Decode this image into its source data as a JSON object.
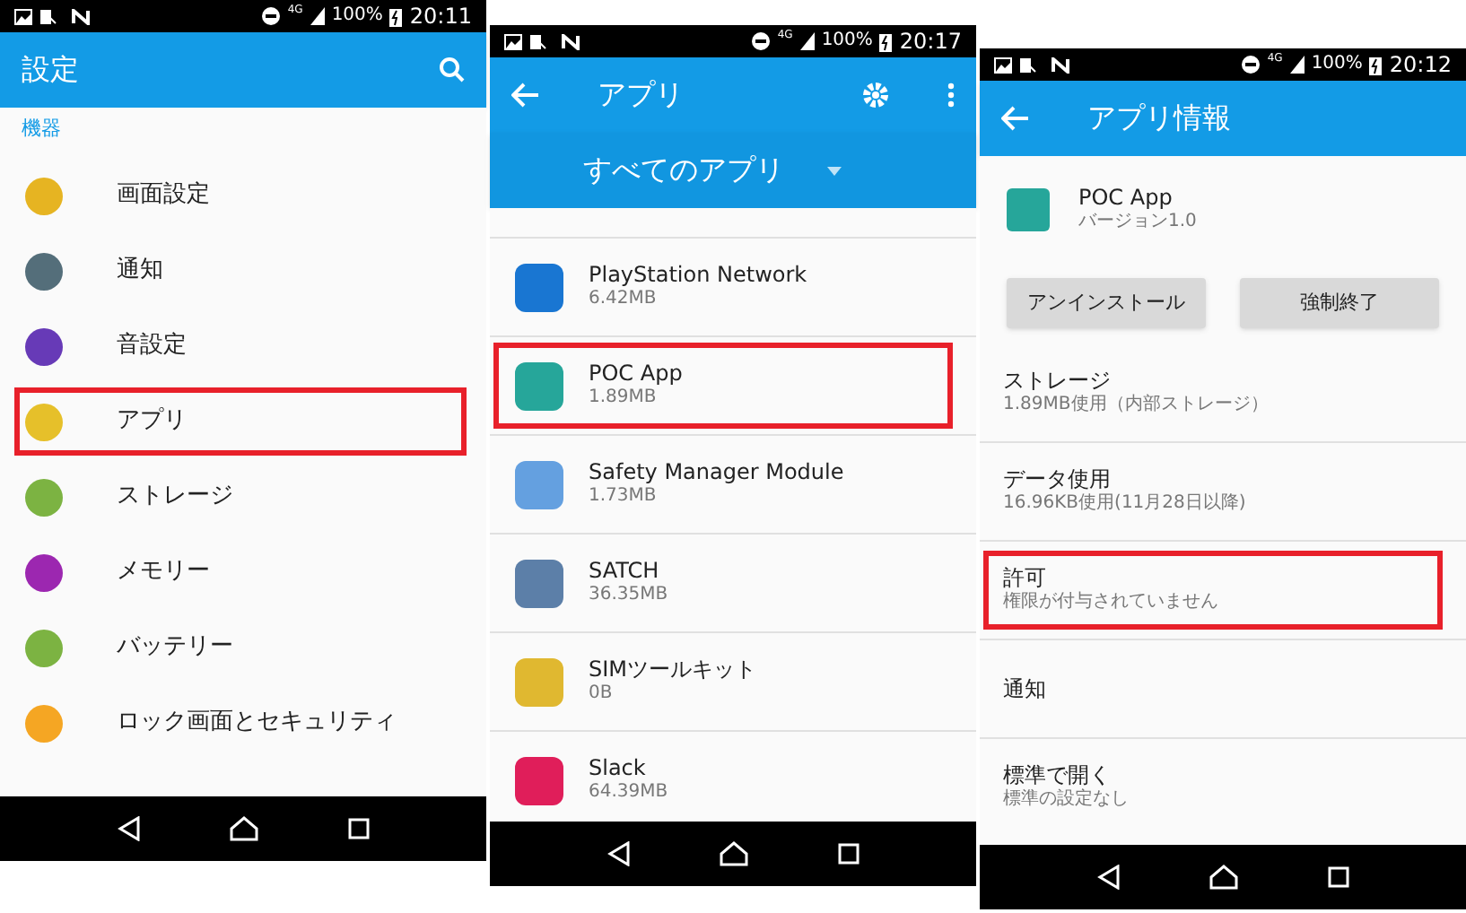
{
  "screens": [
    {
      "kind": "settings",
      "status": {
        "time": "20:11",
        "battery": "100%",
        "network": "4G"
      },
      "title": "設定",
      "section": "機器",
      "items": [
        {
          "label": "画面設定",
          "color": "#e6b422",
          "highlighted": false
        },
        {
          "label": "通知",
          "color": "#546e7a",
          "highlighted": false
        },
        {
          "label": "音設定",
          "color": "#673ab7",
          "highlighted": false
        },
        {
          "label": "アプリ",
          "color": "#e6c02a",
          "highlighted": true
        },
        {
          "label": "ストレージ",
          "color": "#7cb342",
          "highlighted": false
        },
        {
          "label": "メモリー",
          "color": "#9c27b0",
          "highlighted": false
        },
        {
          "label": "バッテリー",
          "color": "#7cb342",
          "highlighted": false
        },
        {
          "label": "ロック画面とセキュリティ",
          "color": "#f5a623",
          "highlighted": false
        }
      ]
    },
    {
      "kind": "apps",
      "status": {
        "time": "20:17",
        "battery": "100%",
        "network": "4G"
      },
      "title": "アプリ",
      "filter": "すべてのアプリ",
      "items": [
        {
          "label": "PlayStation Network",
          "size": "6.42MB",
          "color": "#1976d2",
          "highlighted": false
        },
        {
          "label": "POC App",
          "size": "1.89MB",
          "color": "#26a69a",
          "highlighted": true
        },
        {
          "label": "Safety Manager Module",
          "size": "1.73MB",
          "color": "#64a0e0",
          "highlighted": false
        },
        {
          "label": "SATCH",
          "size": "36.35MB",
          "color": "#5c7fa8",
          "highlighted": false
        },
        {
          "label": "SIMツールキット",
          "size": "0B",
          "color": "#e0b830",
          "highlighted": false
        },
        {
          "label": "Slack",
          "size": "64.39MB",
          "color": "#e01e5a",
          "highlighted": false
        }
      ]
    },
    {
      "kind": "info",
      "status": {
        "time": "20:12",
        "battery": "100%",
        "network": "4G"
      },
      "title": "アプリ情報",
      "app_name": "POC App",
      "version": "バージョン1.0",
      "buttons": [
        "アンインストール",
        "強制終了"
      ],
      "items": [
        {
          "label": "ストレージ",
          "detail": "1.89MB使用（内部ストレージ）",
          "highlighted": false
        },
        {
          "label": "データ使用",
          "detail": "16.96KB使用(11月28日以降)",
          "highlighted": false
        },
        {
          "label": "許可",
          "detail": "権限が付与されていません",
          "highlighted": true
        },
        {
          "label": "通知",
          "highlighted": false
        },
        {
          "label": "標準で開く",
          "detail": "標準の設定なし",
          "highlighted": false
        }
      ]
    }
  ]
}
